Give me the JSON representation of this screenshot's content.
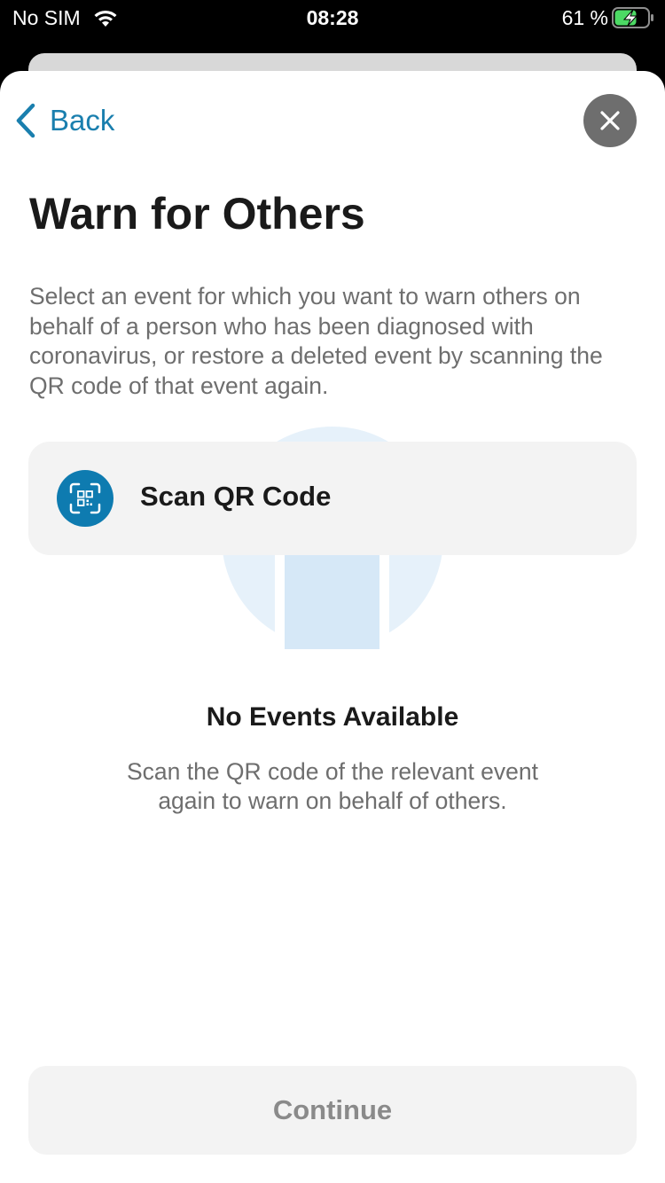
{
  "status_bar": {
    "carrier": "No SIM",
    "time": "08:28",
    "battery_percent": "61 %",
    "wifi_icon": "wifi-icon",
    "battery_icon": "battery-charging-icon"
  },
  "nav": {
    "back_label": "Back",
    "back_icon": "chevron-left-icon",
    "close_icon": "close-icon"
  },
  "page": {
    "title": "Warn for Others",
    "description": "Select an event for which you want to warn others on behalf of a person who has been diagnosed with coronavirus, or restore a deleted event by scanning the QR code of that event again."
  },
  "scan_card": {
    "label": "Scan QR Code",
    "icon": "qr-code-scan-icon"
  },
  "empty_state": {
    "title": "No Events Available",
    "text": "Scan the QR code of the relevant event again to warn on behalf of others."
  },
  "footer": {
    "continue_label": "Continue"
  },
  "colors": {
    "accent": "#1a7fae",
    "icon_bg": "#0e7bb0",
    "card_bg": "#f3f3f3",
    "disabled_text": "#8a8a8a"
  }
}
